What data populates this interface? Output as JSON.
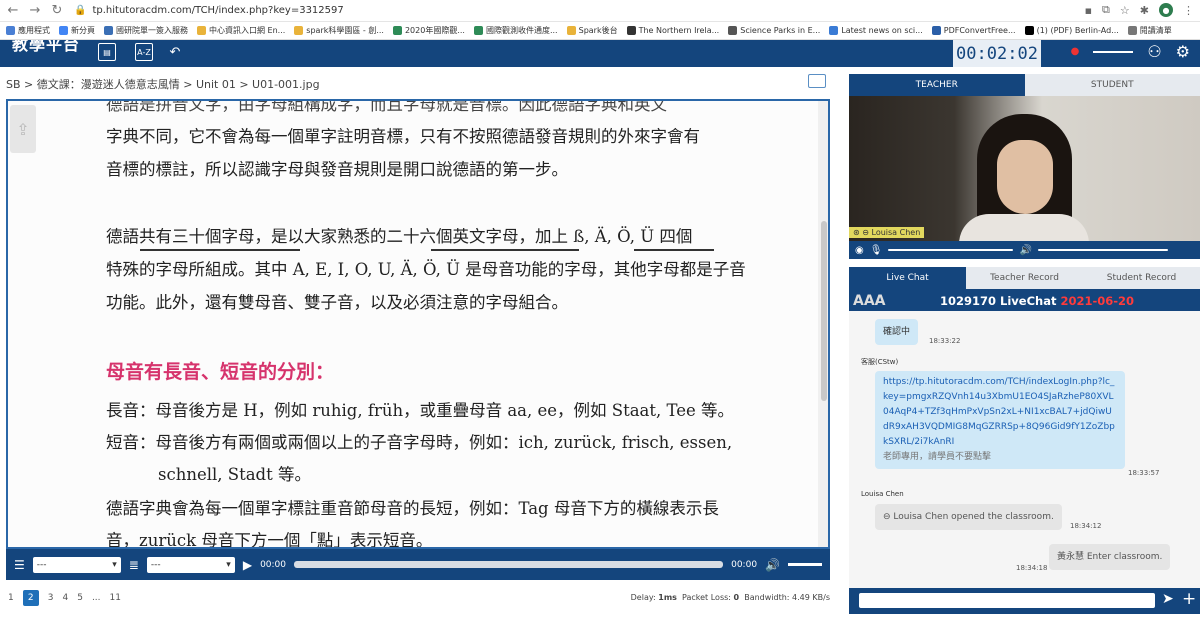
{
  "browser": {
    "url": "tp.hitutoracdm.com/TCH/index.php?key=3312597",
    "bookmarks": [
      "應用程式",
      "新分頁",
      "國研院單一簽入服務",
      "中心資訊入口網 En...",
      "spark科學園區 - 創...",
      "2020年國際觀...",
      "國際觀測收件通度...",
      "Spark後台",
      "The Northern Irela...",
      "Science Parks in E...",
      "Latest news on sci...",
      "PDFConvertFree...",
      "(1) (PDF) Berlin-Ad...",
      "閱讀清單"
    ]
  },
  "header": {
    "logo": "教學平台",
    "timer": "00:02:02"
  },
  "breadcrumb": "SB > 德文課：漫遊迷人德意志風情 > Unit 01 > U01-001.jpg",
  "document": {
    "lines": [
      "德語是拼音文字，由字母組構成字，而且字母就是音標。因此德語字典和英文",
      "字典不同，它不會為每一個單字註明音標，只有不按照德語發音規則的外來字會有",
      "音標的標註，所以認識字母與發音規則是開口說德語的第一步。",
      "德語共有三十個字母，是以大家熟悉的二十六個英文字母，加上 ß, Ä, Ö, Ü 四個",
      "特殊的字母所組成。其中 A, E, I, O, U, Ä, Ö, Ü 是母音功能的字母，其他字母都是子音",
      "功能。此外，還有雙母音、雙子音，以及必須注意的字母組合。",
      "長音：母音後方是 H，例如 ruhig, früh，或重疊母音 aa, ee，例如 Staat, Tee 等。",
      "短音：母音後方有兩個或兩個以上的子音字母時，例如：ich, zurück, frisch, essen,",
      "schnell, Stadt 等。",
      "德語字典會為每一個單字標註重音節母音的長短，例如：Tag 母音下方的橫線表示長",
      "音，zurück 母音下方一個「點」表示短音。"
    ],
    "heading": "母音有長音、短音的分別："
  },
  "player": {
    "select1": "---",
    "select2": "---",
    "time_start": "00:00",
    "time_end": "00:00"
  },
  "pager": {
    "pages": [
      "1",
      "2",
      "3",
      "4",
      "5",
      "...",
      "11"
    ],
    "current": "2"
  },
  "stats": {
    "delay_label": "Delay:",
    "delay": "1ms",
    "loss_label": "Packet Loss:",
    "loss": "0",
    "bw_label": "Bandwidth:",
    "bw": "4.49 KB/s"
  },
  "right": {
    "tab_teacher": "TEACHER",
    "tab_student": "STUDENT",
    "video_name": "Louisa Chen",
    "chat_tabs": [
      "Live Chat",
      "Teacher Record",
      "Student Record"
    ],
    "chat_aa": "AAA",
    "chat_title": "1029170 LiveChat",
    "chat_date": "2021-06-20",
    "messages": {
      "m1_text": "確認中",
      "m1_time": "18:33:22",
      "m2_sender": "客服(CStw)",
      "m2_link": "https://tp.hitutoracdm.com/TCH/indexLogIn.php?lc_key=pmgxRZQVnh14u3XbmU1EO4SJaRzheP80XVL04AqP4+TZf3qHmPxVpSn2xL+NI1xcBAL7+jdQiwUdR9xAH3VQDMIG8MqGZRRSp+8Q96Gid9fY1ZoZbpkSXRL/2i7kAnRI",
      "m2_note": "老師專用，請學員不要點擊",
      "m2_time": "18:33:57",
      "m3_sender": "Louisa Chen",
      "m3_text": "Louisa Chen opened the classroom.",
      "m3_time": "18:34:12",
      "m4_text": "黃永慧 Enter classroom.",
      "m4_time": "18:34:18"
    }
  }
}
